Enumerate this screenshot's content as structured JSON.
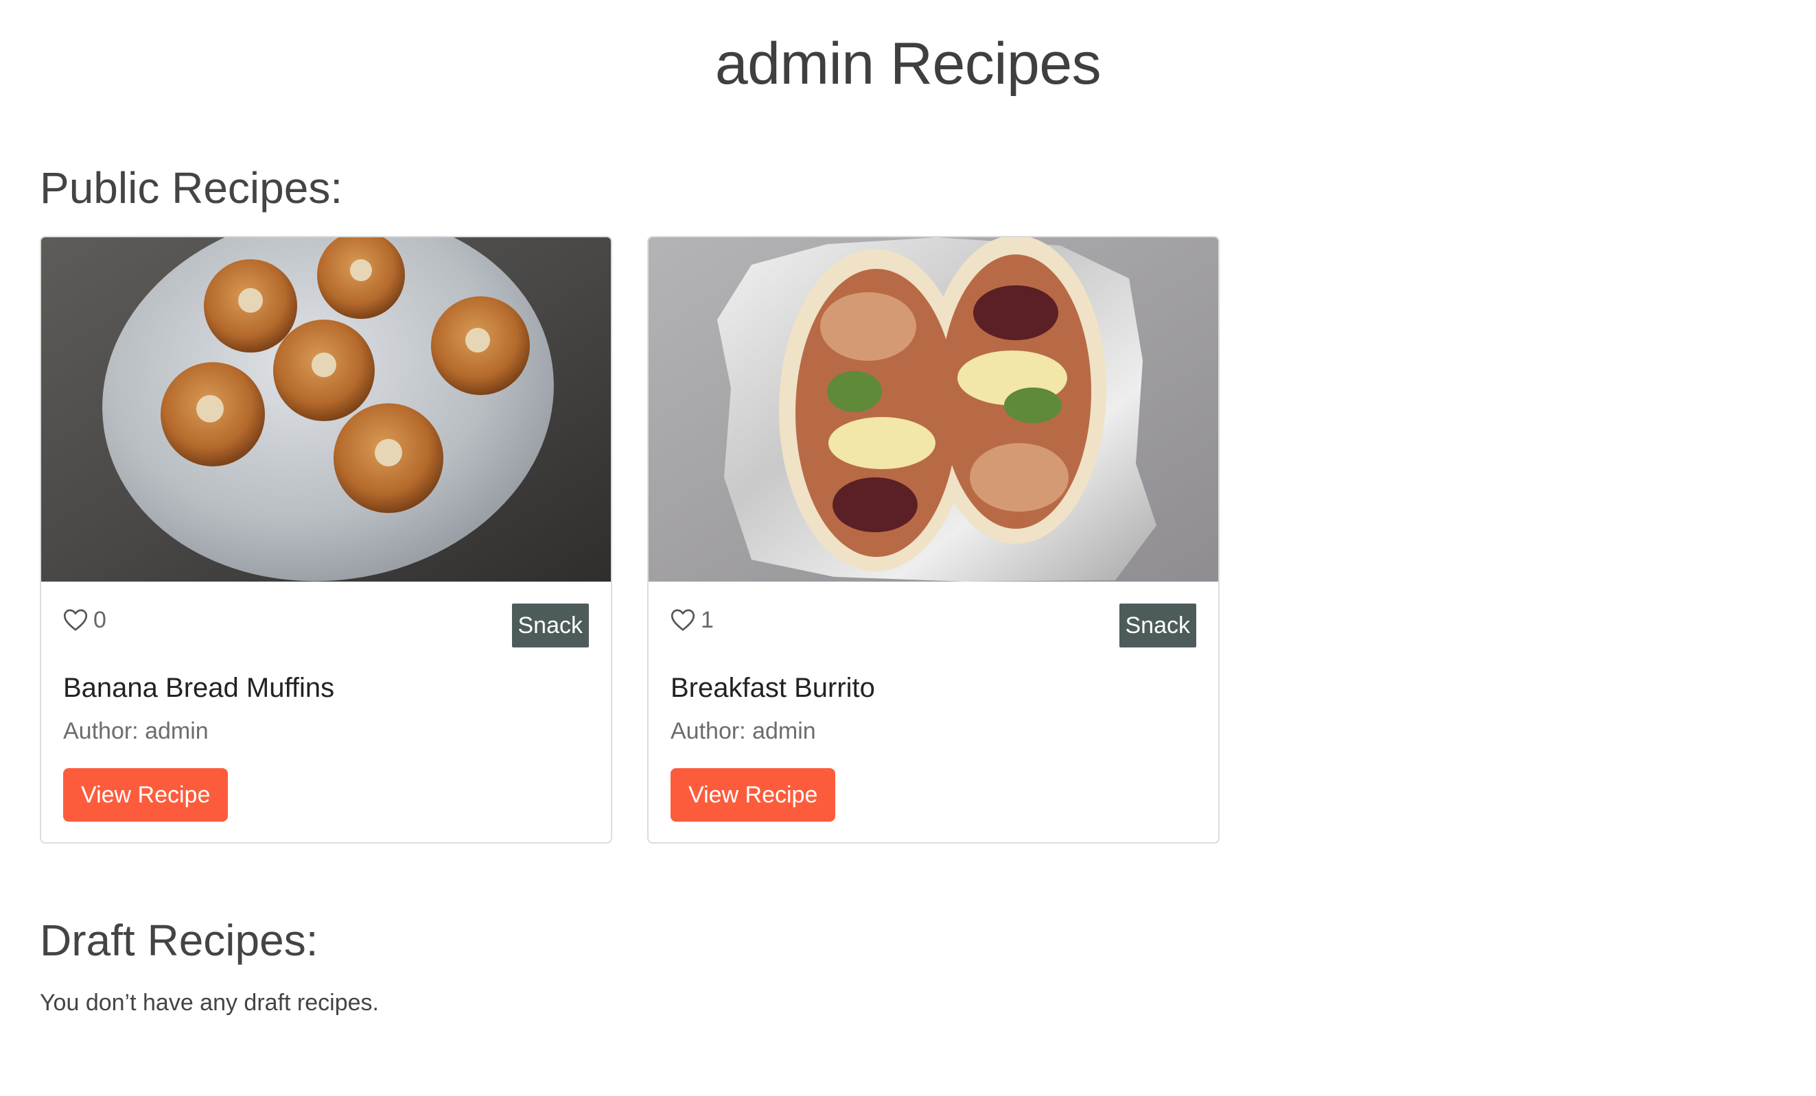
{
  "page": {
    "title": "admin Recipes"
  },
  "public_section": {
    "heading": "Public Recipes:",
    "recipes": [
      {
        "title": "Banana Bread Muffins",
        "author": "Author: admin",
        "likes": "0",
        "category": "Snack",
        "button_label": "View Recipe",
        "image": "banana-bread-muffins-photo"
      },
      {
        "title": "Breakfast Burrito",
        "author": "Author: admin",
        "likes": "1",
        "category": "Snack",
        "button_label": "View Recipe",
        "image": "breakfast-burrito-photo"
      }
    ]
  },
  "draft_section": {
    "heading": "Draft Recipes:",
    "empty_message": "You don’t have any draft recipes."
  },
  "colors": {
    "button": "#fd5c3c",
    "badge": "#4d5b5b",
    "text": "#444444"
  }
}
